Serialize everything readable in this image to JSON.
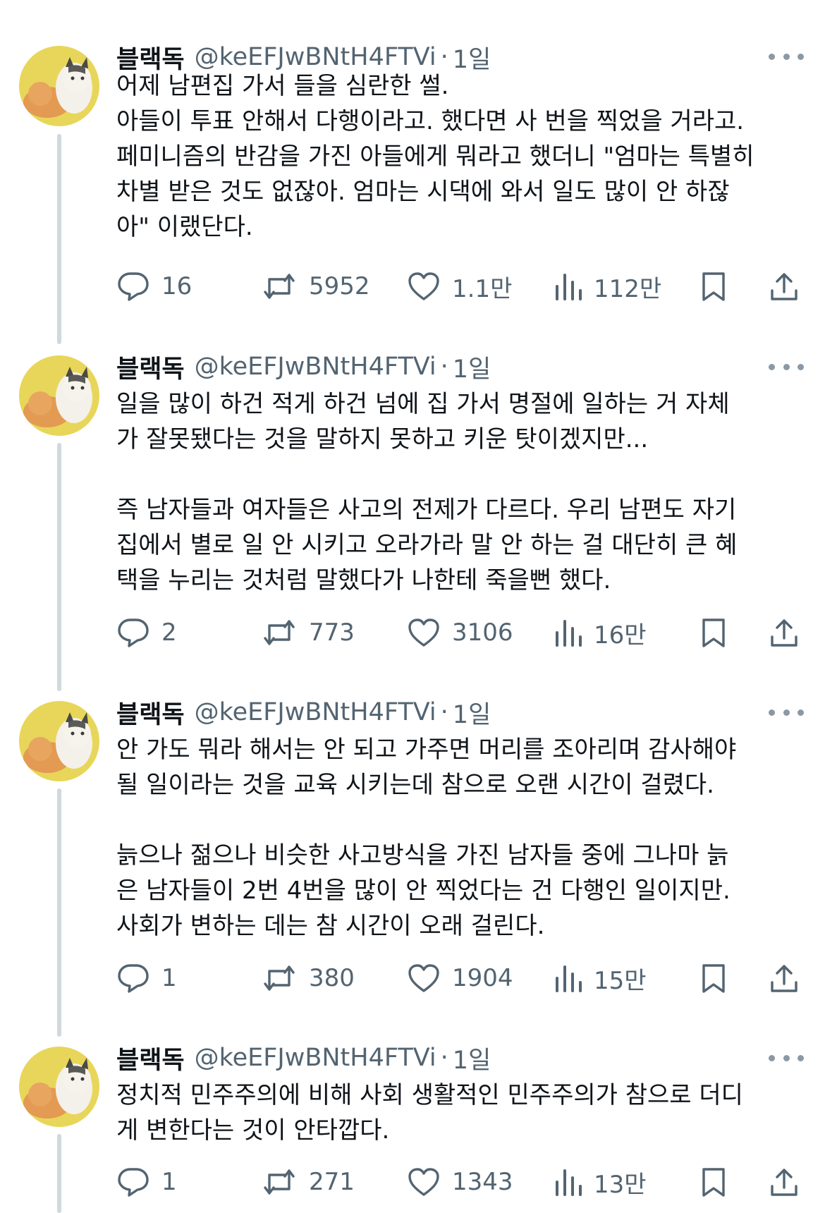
{
  "tweets": [
    {
      "name": "블랙독",
      "handle": "@keEFJwBNtH4FTVi",
      "dot": "·",
      "time": "1일",
      "lines": [
        "어제 남편집 가서 들을 심란한 썰.",
        "아들이 투표 안해서 다행이라고. 했다면 사 번을 찍었을 거라고.",
        "페미니즘의 반감을 가진 아들에게 뭐라고 했더니 \"엄마는 특별히",
        "차별 받은 것도 없잖아. 엄마는 시댁에 와서 일도 많이 안 하잖",
        "아\" 이랬단다."
      ],
      "replies": "16",
      "retweets": "5952",
      "likes": "1.1만",
      "views": "112만"
    },
    {
      "name": "블랙독",
      "handle": "@keEFJwBNtH4FTVi",
      "dot": "·",
      "time": "1일",
      "lines": [
        "일을 많이 하건 적게 하건 넘에 집 가서 명절에 일하는 거 자체",
        "가 잘못됐다는 것을 말하지 못하고 키운 탓이겠지만...",
        "",
        "즉 남자들과 여자들은 사고의 전제가 다르다. 우리 남편도 자기",
        "집에서 별로 일 안 시키고 오라가라 말 안 하는 걸 대단히 큰 혜",
        "택을 누리는 것처럼 말했다가 나한테 죽을뻔 했다."
      ],
      "replies": "2",
      "retweets": "773",
      "likes": "3106",
      "views": "16만"
    },
    {
      "name": "블랙독",
      "handle": "@keEFJwBNtH4FTVi",
      "dot": "·",
      "time": "1일",
      "lines": [
        "안 가도 뭐라 해서는 안 되고 가주면 머리를 조아리며 감사해야",
        "될 일이라는 것을 교육 시키는데 참으로 오랜 시간이 걸렸다.",
        "",
        "늙으나 젊으나 비슷한 사고방식을 가진 남자들 중에 그나마 늙",
        "은 남자들이 2번 4번을 많이 안 찍었다는 건 다행인 일이지만.",
        "사회가 변하는 데는 참 시간이 오래 걸린다."
      ],
      "replies": "1",
      "retweets": "380",
      "likes": "1904",
      "views": "15만"
    },
    {
      "name": "블랙독",
      "handle": "@keEFJwBNtH4FTVi",
      "dot": "·",
      "time": "1일",
      "lines": [
        "정치적 민주주의에 비해 사회 생활적인 민주주의가 참으로 더디",
        "게 변한다는 것이 안타깝다."
      ],
      "replies": "1",
      "retweets": "271",
      "likes": "1343",
      "views": "13만"
    }
  ],
  "colors": {
    "text": "#0f1419",
    "secondary": "#536471",
    "thread_line": "#cfd9de",
    "avatar_bg": "#e8d65a"
  },
  "icons": [
    "reply-icon",
    "retweet-icon",
    "like-icon",
    "views-icon",
    "bookmark-icon",
    "share-icon",
    "more-icon"
  ]
}
